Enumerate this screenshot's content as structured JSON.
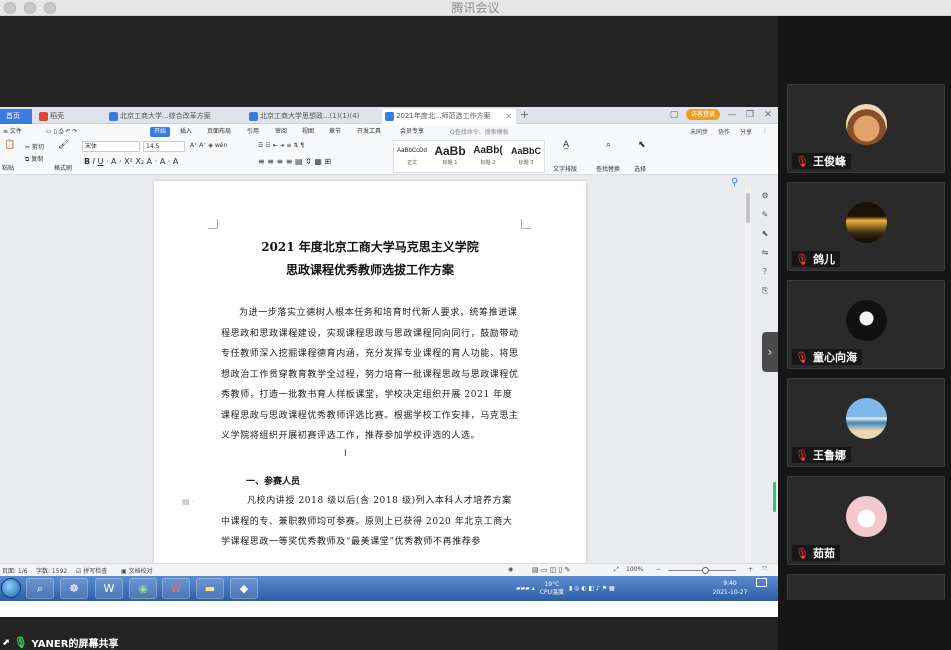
{
  "app": {
    "window_title": "腾讯会议"
  },
  "sharing": {
    "label": "YANER的屏幕共享"
  },
  "wps": {
    "tabs": [
      {
        "label": "首页"
      },
      {
        "label": "稻壳"
      },
      {
        "label": "北京工商大学...综合改革方案"
      },
      {
        "label": "北京工商大学思想政...(1)(1)(4)"
      },
      {
        "label": "2021年度北...师范选工作方案"
      }
    ],
    "member_badge": "访客登录",
    "menus": [
      "≡ 文件",
      "开始",
      "插入",
      "页面布局",
      "引用",
      "审阅",
      "视图",
      "章节",
      "开发工具",
      "会员专享"
    ],
    "search_cmd": "Q查找命令、搜索模板",
    "menu_right": [
      "未同步",
      "协作",
      "分享"
    ],
    "ribbon": {
      "paste": "粘贴",
      "cut": "剪切",
      "copy": "复制",
      "format_painter": "格式刷",
      "font_name": "宋体",
      "font_size": "14.5",
      "styles": [
        {
          "preview": "AaBbCcDd",
          "label": "正文"
        },
        {
          "preview": "AaBb",
          "label": "标题 1"
        },
        {
          "preview": "AaBb(",
          "label": "标题 2"
        },
        {
          "preview": "AaBbC",
          "label": "标题 3"
        }
      ],
      "text_layout": "文字排版",
      "find_replace": "查找替换",
      "select": "选择"
    },
    "doc": {
      "title_line1": "2021 年度北京工商大学马克思主义学院",
      "title_line2": "思政课程优秀教师选拔工作方案",
      "paragraph1": "为进一步落实立德树人根本任务和培育时代新人要求，统筹推进课程思政和思政课程建设，实现课程思政与思政课程同向同行，鼓励带动专任教师深入挖掘课程德育内涵，充分发挥专业课程的育人功能，将思想政治工作贯穿教育教学全过程，努力培育一批课程思政与思政课程优秀教师，打造一批教书育人样板课堂，学校决定组织开展 2021 年度课程思政与思政课程优秀教师评选比赛。根据学校工作安排，马克思主义学院将组织开展初赛评选工作，推荐参加学校评选的人选。",
      "section1": "一、参赛人员",
      "paragraph2": "凡校内讲授 2018 级以后(含 2018 级)列入本科人才培养方案中课程的专、兼职教师均可参赛。原则上已获得 2020 年北京工商大学课程思政一等奖优秀教师及“最美课堂”优秀教师不再推荐参"
    },
    "status": {
      "page": "页面: 1/6",
      "words": "字数: 1592",
      "spell": "拼写检查",
      "proof": "文档校对",
      "zoom": "100%"
    }
  },
  "taskbar": {
    "weather_temp": "19°C",
    "weather_desc": "CPU温度",
    "time": "9:40",
    "date": "2021-10-27"
  },
  "participants": [
    {
      "name": "王俊峰",
      "mic": "muted"
    },
    {
      "name": "鸽儿",
      "mic": "muted"
    },
    {
      "name": "童心向海",
      "mic": "muted"
    },
    {
      "name": "王鲁娜",
      "mic": "muted"
    },
    {
      "name": "茹茹",
      "mic": "muted"
    }
  ],
  "colors": {
    "wps_blue": "#3a7be0",
    "muted_red": "#ff3b3b",
    "speaking_green": "#2fcb55"
  }
}
